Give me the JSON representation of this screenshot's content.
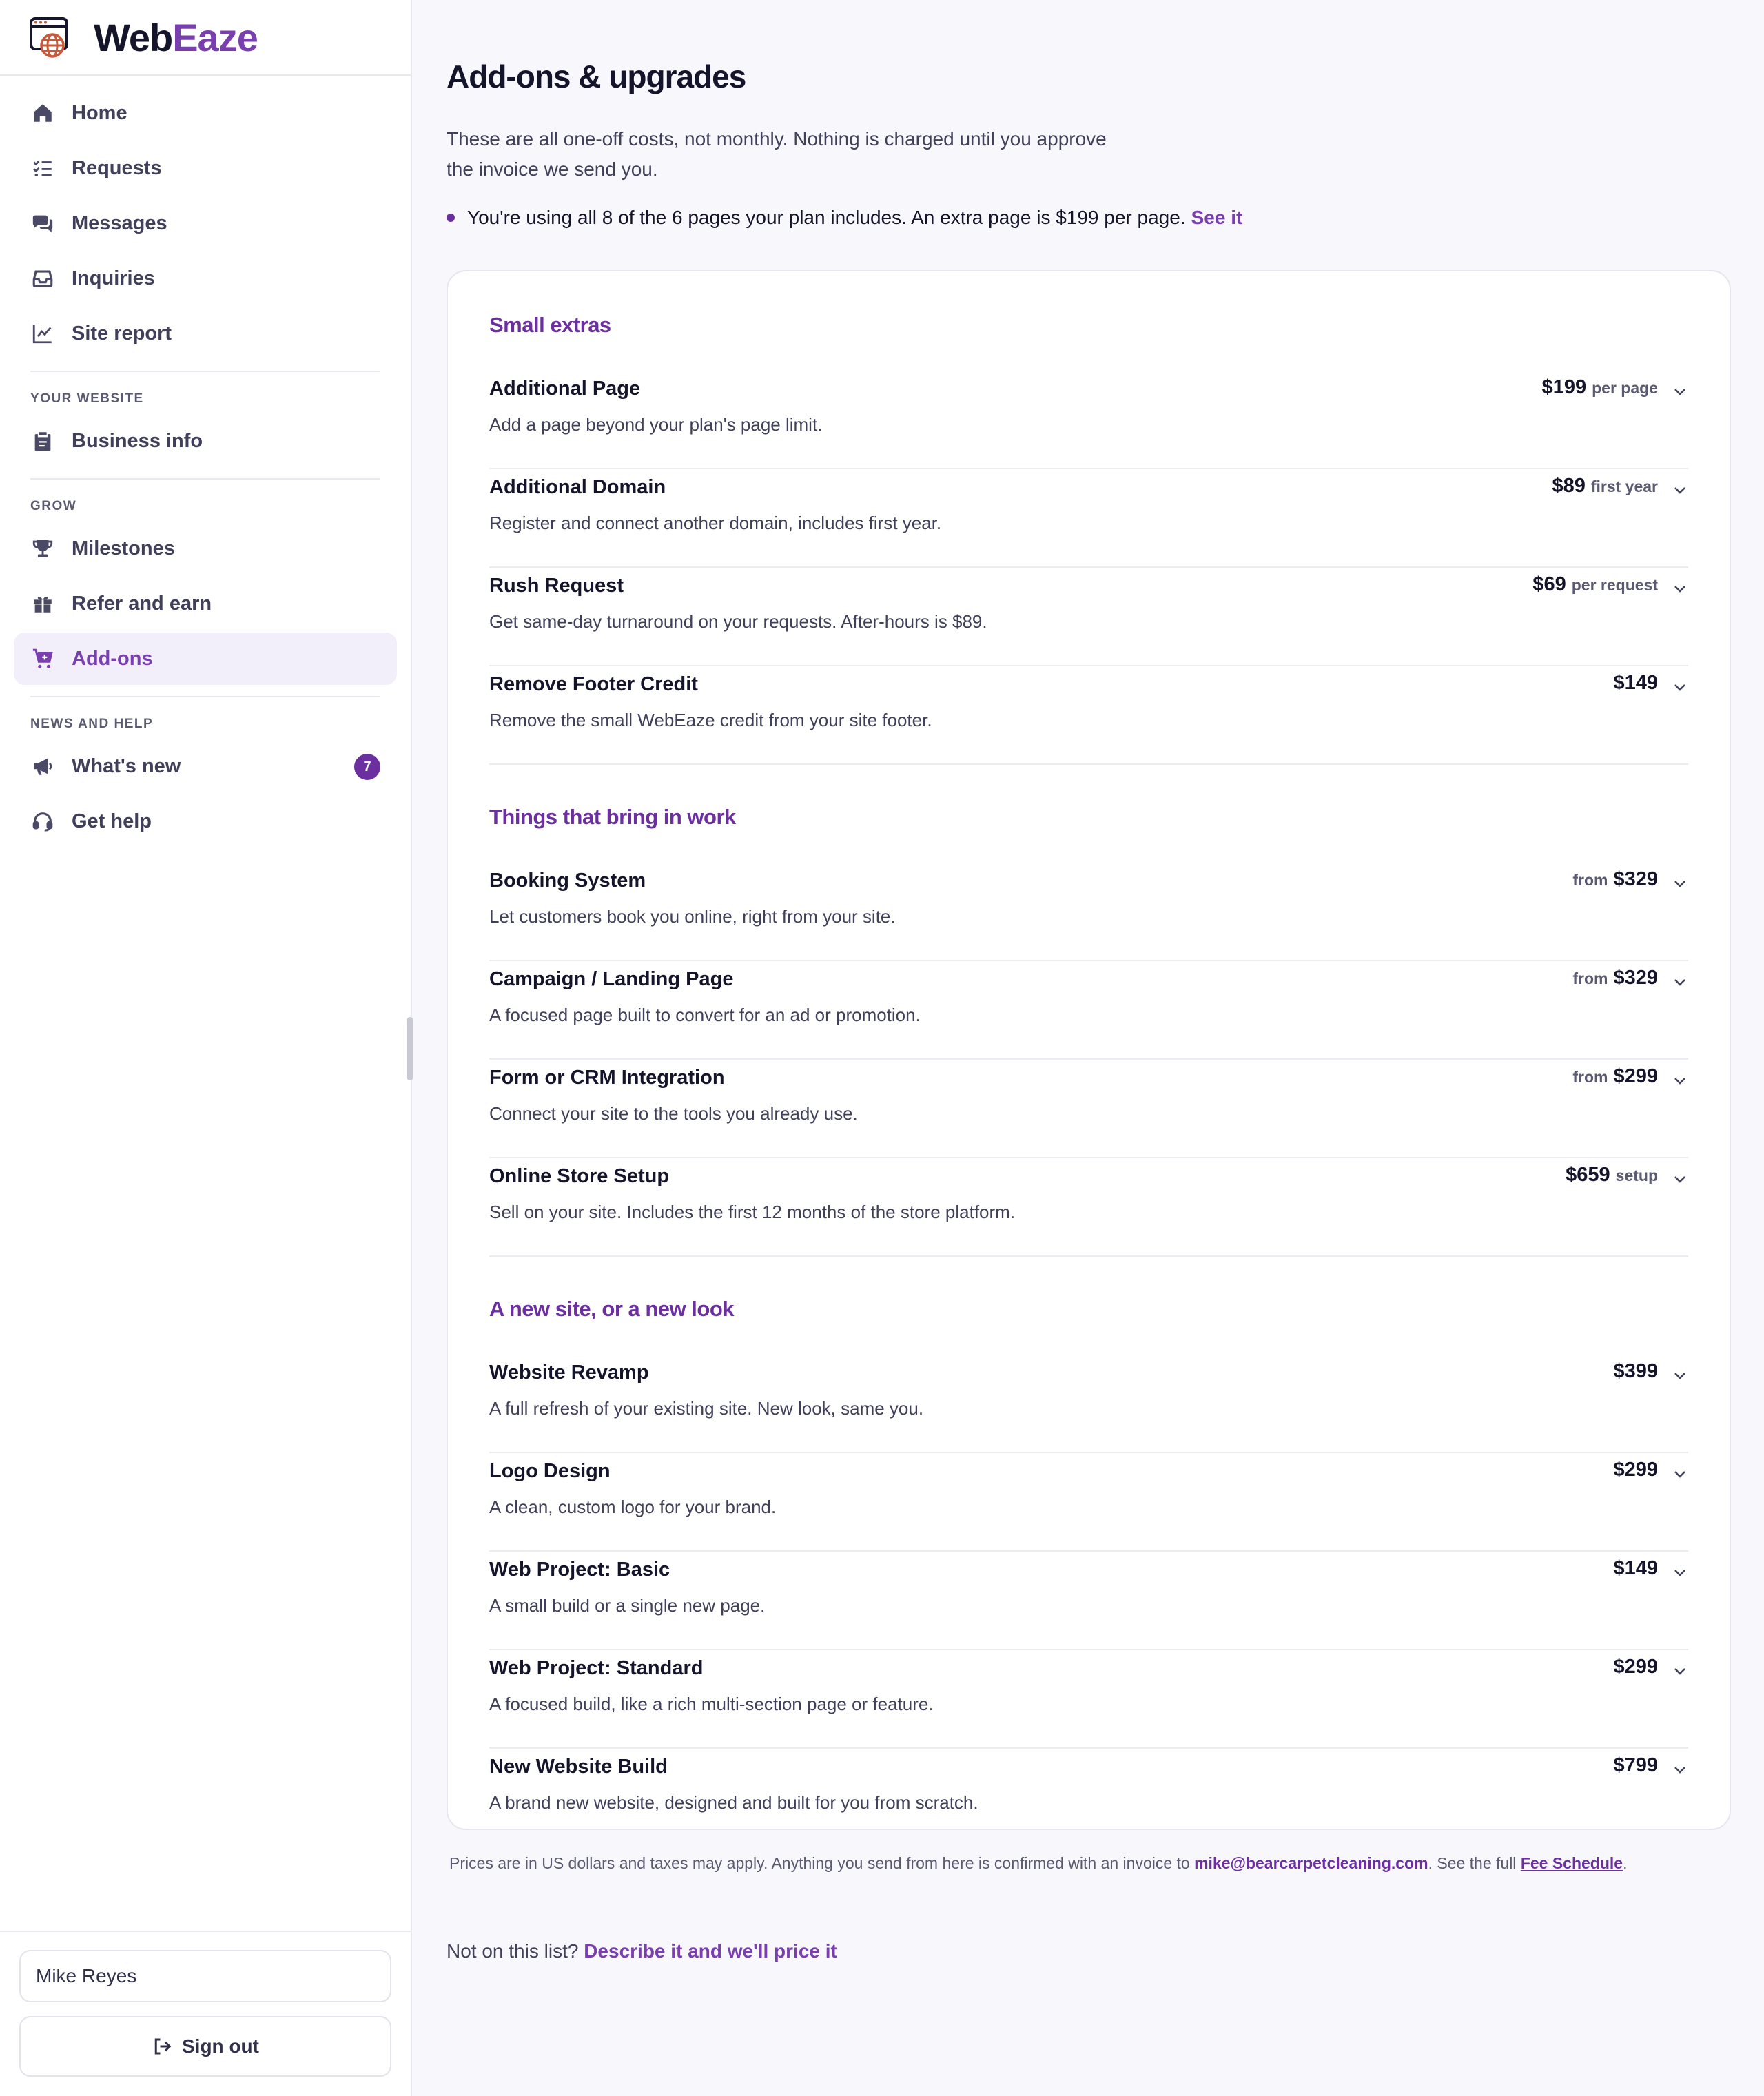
{
  "brand": {
    "name_part1": "Web",
    "name_part2": "Eaze",
    "accent": "#7a3fae"
  },
  "sidebar": {
    "primary": [
      {
        "label": "Home",
        "icon": "home-icon"
      },
      {
        "label": "Requests",
        "icon": "list-check-icon"
      },
      {
        "label": "Messages",
        "icon": "chat-bubbles-icon"
      },
      {
        "label": "Inquiries",
        "icon": "inbox-icon"
      },
      {
        "label": "Site report",
        "icon": "line-chart-icon"
      }
    ],
    "section_website": "YOUR WEBSITE",
    "website": [
      {
        "label": "Business info",
        "icon": "clipboard-icon"
      }
    ],
    "section_grow": "GROW",
    "grow": [
      {
        "label": "Milestones",
        "icon": "trophy-icon"
      },
      {
        "label": "Refer and earn",
        "icon": "gift-icon"
      },
      {
        "label": "Add-ons",
        "icon": "cart-plus-icon",
        "active": true
      }
    ],
    "section_news": "NEWS AND HELP",
    "news": [
      {
        "label": "What's new",
        "icon": "megaphone-icon",
        "badge": "7"
      },
      {
        "label": "Get help",
        "icon": "headset-icon"
      }
    ],
    "user_name": "Mike Reyes",
    "signout_label": "Sign out"
  },
  "main": {
    "title": "Add-ons & upgrades",
    "lede": "These are all one-off costs, not monthly. Nothing is charged until you approve the invoice we send you.",
    "notice_text": "You're using all 8 of the 6 pages your plan includes. An extra page is $199 per page.",
    "notice_link": "See it",
    "sections": [
      {
        "title": "Small extras",
        "items": [
          {
            "name": "Additional Page",
            "desc": "Add a page beyond your plan's page limit.",
            "price_pre": "",
            "price": "$199",
            "price_suf": "per page"
          },
          {
            "name": "Additional Domain",
            "desc": "Register and connect another domain, includes first year.",
            "price_pre": "",
            "price": "$89",
            "price_suf": "first year"
          },
          {
            "name": "Rush Request",
            "desc": "Get same-day turnaround on your requests. After-hours is $89.",
            "price_pre": "",
            "price": "$69",
            "price_suf": "per request"
          },
          {
            "name": "Remove Footer Credit",
            "desc": "Remove the small WebEaze credit from your site footer.",
            "price_pre": "",
            "price": "$149",
            "price_suf": ""
          }
        ]
      },
      {
        "title": "Things that bring in work",
        "items": [
          {
            "name": "Booking System",
            "desc": "Let customers book you online, right from your site.",
            "price_pre": "from",
            "price": "$329",
            "price_suf": ""
          },
          {
            "name": "Campaign / Landing Page",
            "desc": "A focused page built to convert for an ad or promotion.",
            "price_pre": "from",
            "price": "$329",
            "price_suf": ""
          },
          {
            "name": "Form or CRM Integration",
            "desc": "Connect your site to the tools you already use.",
            "price_pre": "from",
            "price": "$299",
            "price_suf": ""
          },
          {
            "name": "Online Store Setup",
            "desc": "Sell on your site. Includes the first 12 months of the store platform.",
            "price_pre": "",
            "price": "$659",
            "price_suf": "setup"
          }
        ]
      },
      {
        "title": "A new site, or a new look",
        "items": [
          {
            "name": "Website Revamp",
            "desc": "A full refresh of your existing site. New look, same you.",
            "price_pre": "",
            "price": "$399",
            "price_suf": ""
          },
          {
            "name": "Logo Design",
            "desc": "A clean, custom logo for your brand.",
            "price_pre": "",
            "price": "$299",
            "price_suf": ""
          },
          {
            "name": "Web Project: Basic",
            "desc": "A small build or a single new page.",
            "price_pre": "",
            "price": "$149",
            "price_suf": ""
          },
          {
            "name": "Web Project: Standard",
            "desc": "A focused build, like a rich multi-section page or feature.",
            "price_pre": "",
            "price": "$299",
            "price_suf": ""
          },
          {
            "name": "New Website Build",
            "desc": "A brand new website, designed and built for you from scratch.",
            "price_pre": "",
            "price": "$799",
            "price_suf": ""
          }
        ]
      }
    ],
    "footnote_text": "Prices are in US dollars and taxes may apply. Anything you send from here is confirmed with an invoice to",
    "footnote_email": "mike@bearcarpetcleaning.com",
    "footnote_mid": ". See the full",
    "footnote_link": "Fee Schedule",
    "footnote_end": ".",
    "notlisted_text": "Not on this list?",
    "notlisted_link": "Describe it and we'll price it"
  }
}
